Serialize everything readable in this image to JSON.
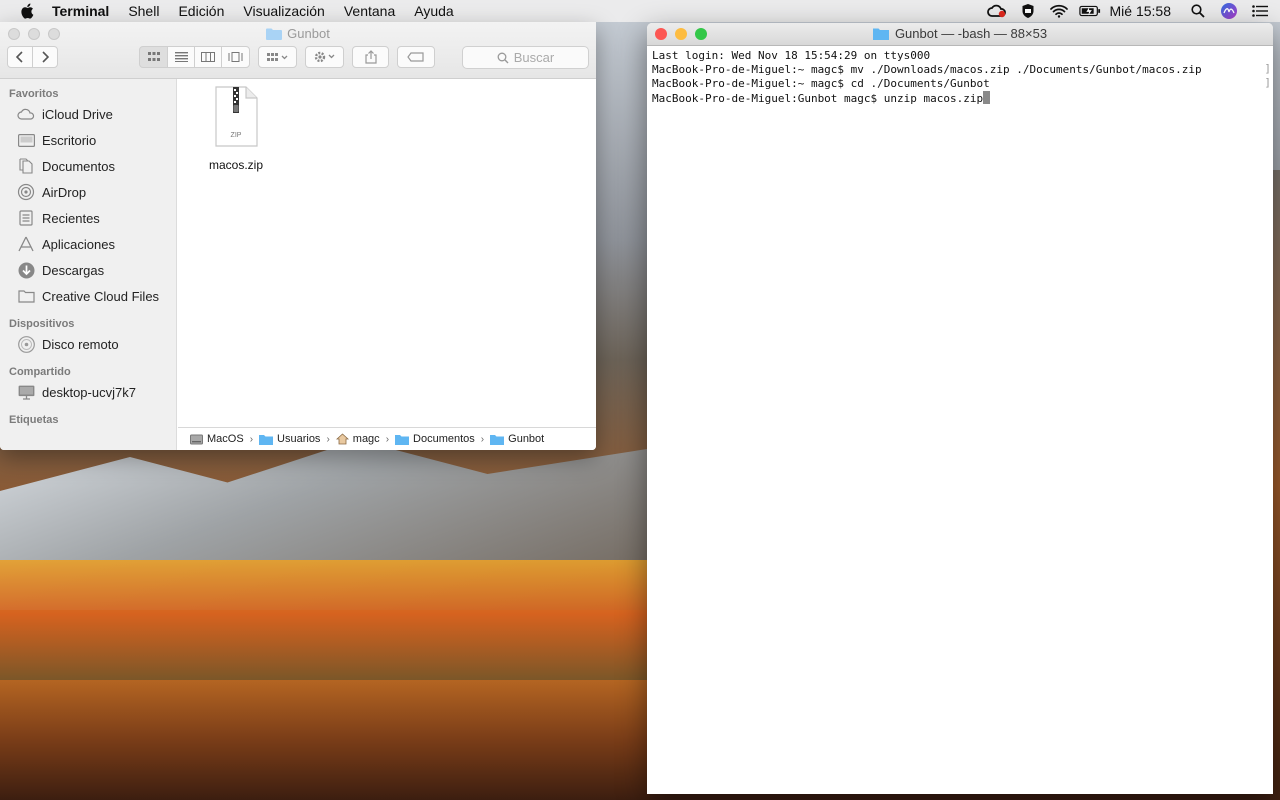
{
  "menubar": {
    "items": [
      "Terminal",
      "Shell",
      "Edición",
      "Visualización",
      "Ventana",
      "Ayuda"
    ],
    "clock": "Mié 15:58"
  },
  "finder": {
    "title": "Gunbot",
    "search_placeholder": "Buscar",
    "sidebar": {
      "favorites_header": "Favoritos",
      "favorites": [
        {
          "label": "iCloud Drive",
          "icon": "cloud-icon"
        },
        {
          "label": "Escritorio",
          "icon": "desktop-icon"
        },
        {
          "label": "Documentos",
          "icon": "document-icon"
        },
        {
          "label": "AirDrop",
          "icon": "airdrop-icon"
        },
        {
          "label": "Recientes",
          "icon": "recents-icon"
        },
        {
          "label": "Aplicaciones",
          "icon": "applications-icon"
        },
        {
          "label": "Descargas",
          "icon": "downloads-icon"
        },
        {
          "label": "Creative Cloud Files",
          "icon": "folder-icon"
        }
      ],
      "devices_header": "Dispositivos",
      "devices": [
        {
          "label": "Disco remoto",
          "icon": "disc-icon"
        }
      ],
      "shared_header": "Compartido",
      "shared": [
        {
          "label": "desktop-ucvj7k7",
          "icon": "computer-icon"
        }
      ],
      "tags_header": "Etiquetas"
    },
    "files": [
      {
        "name": "macos.zip",
        "badge": "ZIP"
      }
    ],
    "pathbar": [
      "MacOS",
      "Usuarios",
      "magc",
      "Documentos",
      "Gunbot"
    ]
  },
  "terminal": {
    "title": "Gunbot — -bash — 88×53",
    "lines": [
      "Last login: Wed Nov 18 15:54:29 on ttys000",
      "MacBook-Pro-de-Miguel:~ magc$ mv ./Downloads/macos.zip ./Documents/Gunbot/macos.zip",
      "MacBook-Pro-de-Miguel:~ magc$ cd ./Documents/Gunbot",
      "MacBook-Pro-de-Miguel:Gunbot magc$ unzip macos.zip"
    ]
  },
  "colors": {
    "close": "#fc5753",
    "minimize": "#fdbc40",
    "zoom": "#33c748",
    "folder_blue": "#5fb6f2"
  }
}
